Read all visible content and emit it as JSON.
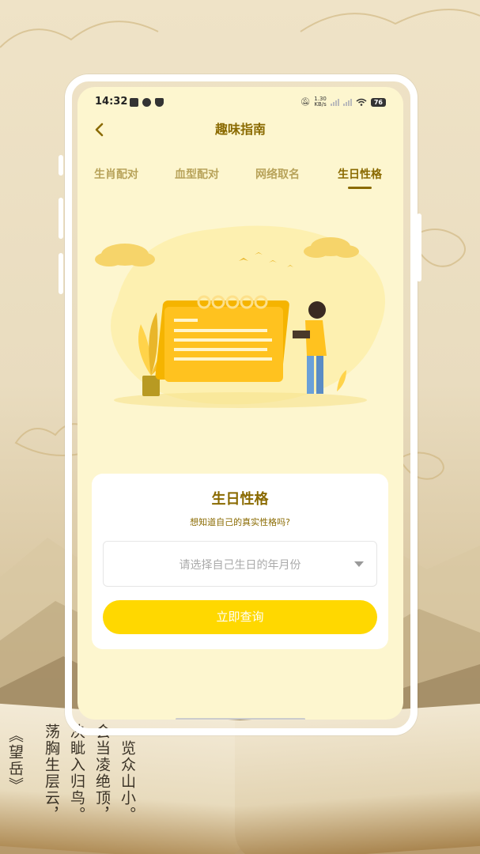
{
  "status_bar": {
    "time": "14:32",
    "net_speed_value": "1.30",
    "net_speed_unit": "KB/s",
    "battery": "76"
  },
  "header": {
    "title": "趣味指南"
  },
  "tabs": [
    {
      "label": "生肖配对",
      "active": false
    },
    {
      "label": "血型配对",
      "active": false
    },
    {
      "label": "网络取名",
      "active": false
    },
    {
      "label": "生日性格",
      "active": true
    }
  ],
  "card": {
    "title": "生日性格",
    "subtitle": "想知道自己的真实性格吗?",
    "date_placeholder": "请选择自己生日的年月份",
    "submit_label": "立即查询"
  },
  "background": {
    "poem_col1": "荡胸生层云，",
    "poem_col2": "决眦入归鸟。",
    "poem_col3": "会当凌绝顶，",
    "poem_col4": "一览众山小。",
    "poem_title": "《望岳》"
  },
  "colors": {
    "accent": "#8a6a00",
    "button": "#ffd800",
    "screen_bg": "#fdf6cf",
    "tab_inactive": "#b8a35a"
  },
  "icons": [
    "back-chevron-icon",
    "dropdown-arrow-icon",
    "wifi-icon",
    "signal-icon",
    "battery-icon"
  ]
}
